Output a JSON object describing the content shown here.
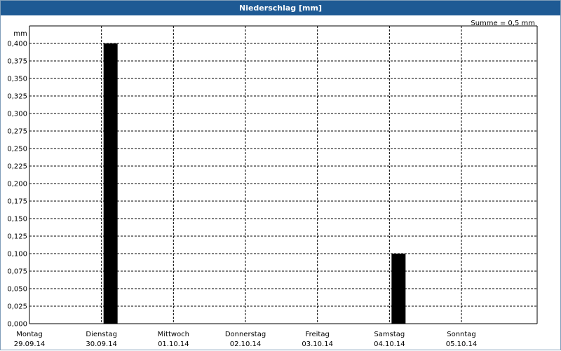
{
  "window": {
    "title": "Niederschlag [mm]"
  },
  "summary": {
    "text": "Summe = 0,5 mm"
  },
  "chart_data": {
    "type": "bar",
    "title": "Niederschlag [mm]",
    "ylabel": "mm",
    "xlabel": "",
    "ylim": [
      0,
      0.425
    ],
    "yticks": [
      "0,000",
      "0,025",
      "0,050",
      "0,075",
      "0,100",
      "0,125",
      "0,150",
      "0,175",
      "0,200",
      "0,225",
      "0,250",
      "0,275",
      "0,300",
      "0,325",
      "0,350",
      "0,375",
      "0,400"
    ],
    "categories": [
      {
        "day": "Montag",
        "date": "29.09.14"
      },
      {
        "day": "Dienstag",
        "date": "30.09.14"
      },
      {
        "day": "Mittwoch",
        "date": "01.10.14"
      },
      {
        "day": "Donnerstag",
        "date": "02.10.14"
      },
      {
        "day": "Freitag",
        "date": "03.10.14"
      },
      {
        "day": "Samstag",
        "date": "04.10.14"
      },
      {
        "day": "Sonntag",
        "date": "05.10.14"
      }
    ],
    "values": [
      0,
      0.4,
      0,
      0,
      0,
      0.1,
      0
    ],
    "grid": true,
    "bar_color": "#000000"
  }
}
